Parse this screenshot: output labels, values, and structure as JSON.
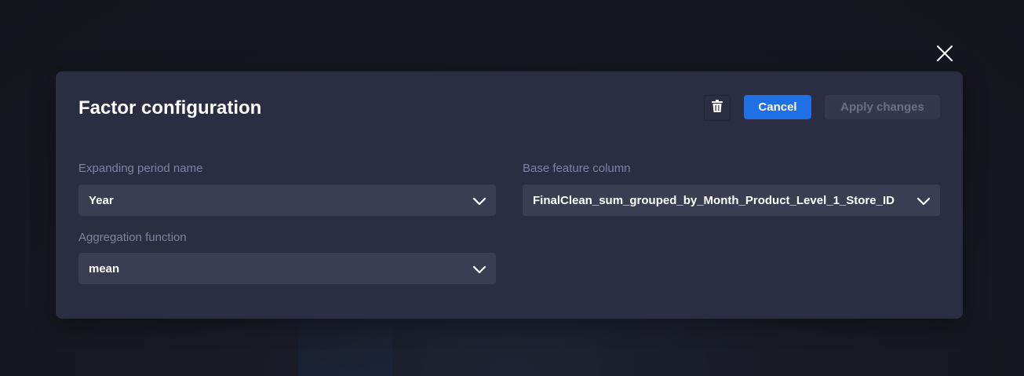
{
  "modal": {
    "title": "Factor configuration",
    "actions": {
      "delete_icon": "trash-icon",
      "cancel_label": "Cancel",
      "apply_label": "Apply changes"
    },
    "fields": {
      "expanding_period": {
        "label": "Expanding period name",
        "value": "Year"
      },
      "base_feature": {
        "label": "Base feature column",
        "value": "FinalClean_sum_grouped_by_Month_Product_Level_1_Store_ID"
      },
      "aggregation": {
        "label": "Aggregation function",
        "value": "mean"
      }
    }
  },
  "overlay": {
    "close_icon": "close-icon"
  },
  "colors": {
    "primary": "#1f6fe5",
    "modal_bg": "#2b2d42",
    "select_bg": "#3b3d53",
    "label": "#7f84a3",
    "disabled_text": "#6b6f88"
  }
}
